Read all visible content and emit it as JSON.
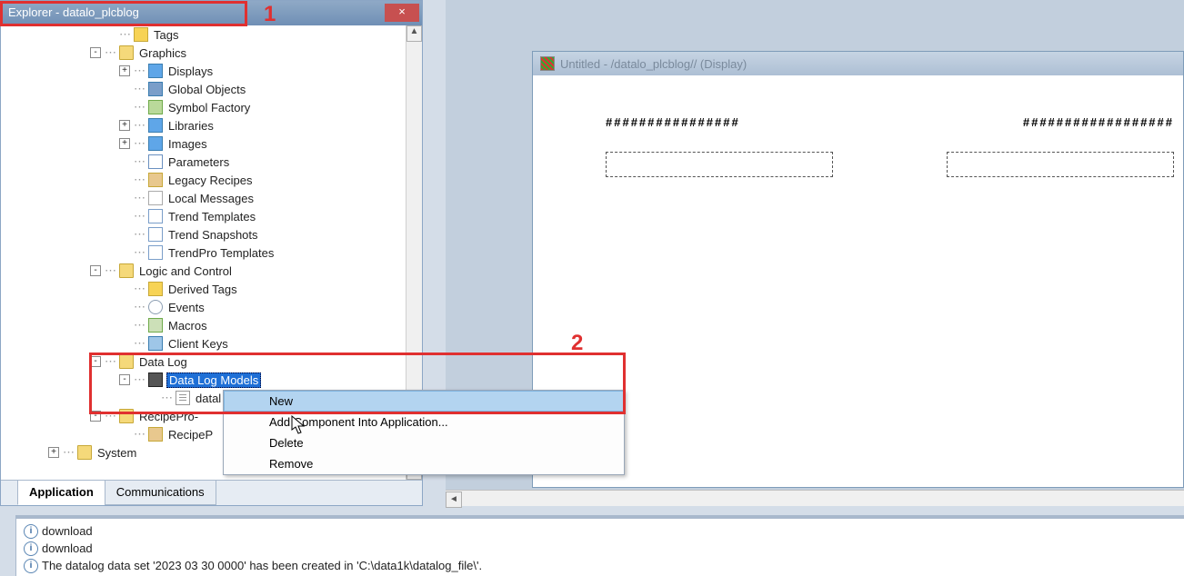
{
  "explorer": {
    "title": "Explorer - datalo_plcblog",
    "close_label": "×",
    "scroll_up": "▲",
    "scroll_down": "▼",
    "tabs": {
      "application": "Application",
      "communications": "Communications"
    }
  },
  "tree": {
    "tags": "Tags",
    "graphics": "Graphics",
    "displays": "Displays",
    "global_objects": "Global Objects",
    "symbol_factory": "Symbol Factory",
    "libraries": "Libraries",
    "images": "Images",
    "parameters": "Parameters",
    "legacy_recipes": "Legacy Recipes",
    "local_messages": "Local Messages",
    "trend_templates": "Trend Templates",
    "trend_snapshots": "Trend Snapshots",
    "trendpro_templates": "TrendPro Templates",
    "logic_control": "Logic and Control",
    "derived_tags": "Derived Tags",
    "events": "Events",
    "macros": "Macros",
    "client_keys": "Client Keys",
    "data_log": "Data Log",
    "data_log_models": "Data Log Models",
    "datalog_item": "datal",
    "recipepro": "RecipePro-",
    "recipep": "RecipeP",
    "system": "System"
  },
  "context_menu": {
    "new": "New",
    "add_component": "Add Component Into Application...",
    "delete": "Delete",
    "remove": "Remove"
  },
  "display_window": {
    "title": "Untitled - /datalo_plcblog// (Display)",
    "hash1": "################",
    "hash2": "##################",
    "hscroll_left": "◄"
  },
  "output": {
    "l1": "download",
    "l2": "download",
    "l3": "The datalog data set '2023 03 30 0000' has been created in 'C:\\data1k\\datalog_file\\'.",
    "info": "i"
  },
  "annotations": {
    "one": "1",
    "two": "2"
  }
}
